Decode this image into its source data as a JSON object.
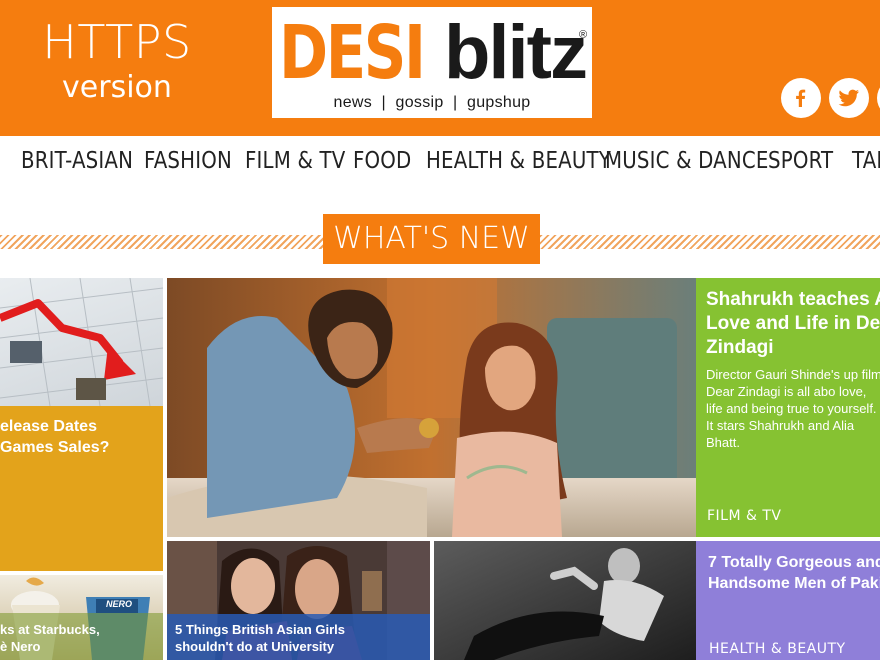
{
  "header": {
    "https_title": "HTTPS",
    "https_subtitle": "version",
    "logo_left": "DESI",
    "logo_right": "blitz",
    "logo_reg": "®",
    "logo_tagline": "news  |  gossip  |  gupshup",
    "social": [
      "facebook-icon",
      "twitter-icon",
      "instagram-icon"
    ],
    "accent_color": "#f57d0f"
  },
  "nav": {
    "items": [
      "BRIT-ASIAN",
      "FASHION",
      "FILM & TV",
      "FOOD",
      "HEALTH & BEAUTY",
      "MUSIC & DANCE",
      "SPORT",
      "TAB"
    ]
  },
  "section": {
    "heading": "WHAT'S NEW"
  },
  "tiles": {
    "games": {
      "title_line1": "elease Dates",
      "title_line2": "Games Sales?",
      "color": "#e3a31b"
    },
    "starbucks": {
      "title_line1": "ks at Starbucks,",
      "title_line2": "è Nero",
      "label": "NERO"
    },
    "featured": {
      "title": "Shahrukh teaches A Love and Life in De Zindagi",
      "summary": "Director Gauri Shinde's up film Dear Zindagi is all abo love, life and being true to yourself. It stars Shahrukh and Alia Bhatt.",
      "category": "FILM & TV",
      "color": "#86c232"
    },
    "girls": {
      "title_line1": "5 Things British Asian Girls",
      "title_line2": "shouldn't do at University"
    },
    "men": {
      "title": "7 Totally Gorgeous and Handsome Men of Paki",
      "category": "HEALTH & BEAUTY",
      "color": "#8f7fd9"
    }
  }
}
